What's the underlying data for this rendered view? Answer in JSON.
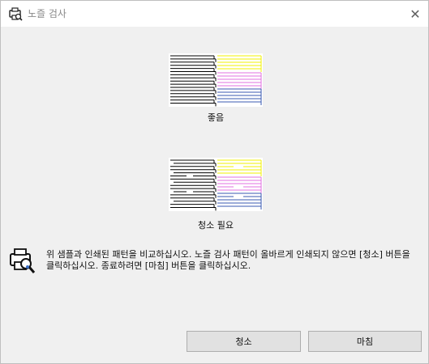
{
  "window": {
    "title": "노즐 검사",
    "close_symbol": "✕"
  },
  "patterns": {
    "good_label": "좋음",
    "needs_cleaning_label": "청소 필요"
  },
  "instructions": {
    "text": "위 샘플과 인쇄된 패턴을 비교하십시오. 노즐 검사 패턴이 올바르게 인쇄되지 않으면 [청소] 버튼을 클릭하십시오. 종료하려면 [마침] 버튼을 클릭하십시오."
  },
  "buttons": {
    "clean_label": "청소",
    "finish_label": "마침"
  },
  "colors": {
    "black_lines": "#000000",
    "yellow_lines": "#f2f200",
    "magenta_lines": "#e070e0",
    "blue_lines": "#3a5ab0",
    "accent_button_bg": "#e1e1e1"
  },
  "icons": {
    "title": "printer-nozzle-check-icon",
    "info": "printer-info-icon",
    "close": "close-icon"
  }
}
